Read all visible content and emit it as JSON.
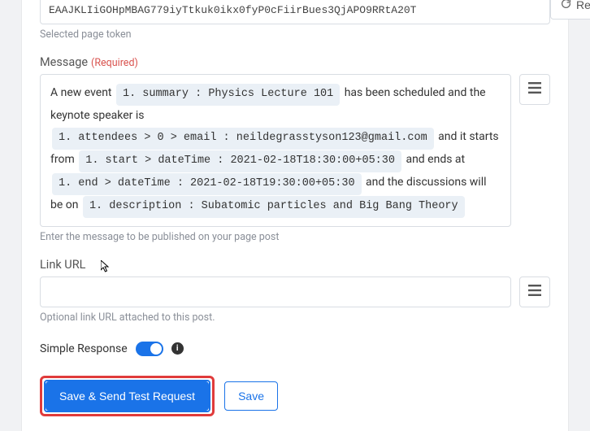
{
  "token": {
    "value": "EAAJKLIiGOHpMBAG779iyTtkuk0ikx0fyP0cFiirBues3QjAPO9RRtA20T",
    "helper": "Selected page token"
  },
  "refresh_label": "Refresh",
  "message": {
    "label": "Message",
    "required": "(Required)",
    "parts": {
      "p0": "A new event ",
      "pill0": "1. summary : Physics Lecture 101",
      "p1": " has been scheduled and the keynote speaker is ",
      "pill1": "1. attendees > 0 > email : neildegrasstyson123@gmail.com",
      "p2": " and it starts from ",
      "pill2": "1. start > dateTime : 2021-02-18T18:30:00+05:30",
      "p3": " and ends at ",
      "pill3": "1. end > dateTime : 2021-02-18T19:30:00+05:30",
      "p4": " and the discussions will be on ",
      "pill4": "1. description : Subatomic particles and Big Bang Theory"
    },
    "helper": "Enter the message to be published on your page post"
  },
  "link_url": {
    "label": "Link URL",
    "value": "",
    "helper": "Optional link URL attached to this post."
  },
  "simple_response": {
    "label": "Simple Response",
    "enabled": true
  },
  "actions": {
    "primary": "Save & Send Test Request",
    "secondary": "Save"
  }
}
